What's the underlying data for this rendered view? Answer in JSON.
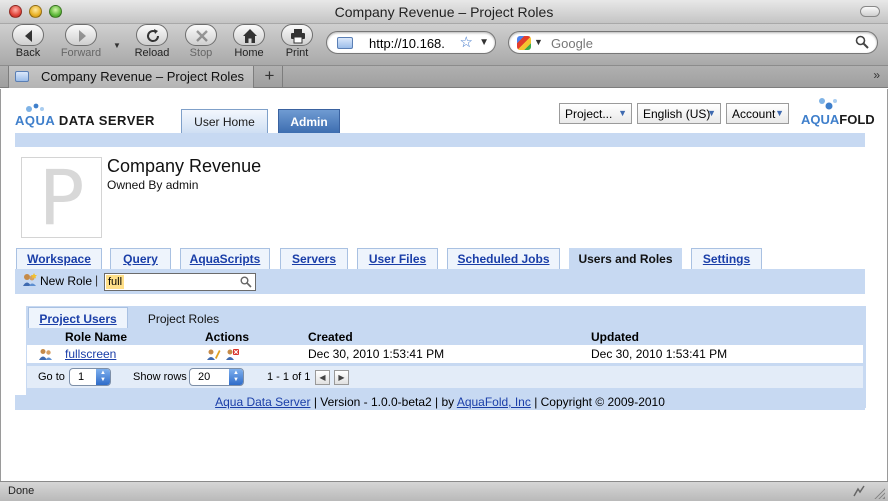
{
  "window": {
    "title": "Company Revenue – Project Roles"
  },
  "toolbar": {
    "back_label": "Back",
    "forward_label": "Forward",
    "reload_label": "Reload",
    "stop_label": "Stop",
    "home_label": "Home",
    "print_label": "Print",
    "url": "http://10.168.",
    "search_placeholder": "Google"
  },
  "tabs": {
    "active_title": "Company Revenue – Project Roles",
    "new_tab": "+"
  },
  "header": {
    "logo_left": {
      "aqua": "AQUA",
      "rest": " DATA SERVER"
    },
    "logo_right": {
      "aqua": "AQUA",
      "rest": "FOLD"
    },
    "app_tabs": [
      "User Home",
      "Admin"
    ],
    "project_select": "Project...",
    "language_select": "English (US)",
    "account_select": "Account"
  },
  "project": {
    "avatar_letter": "P",
    "name": "Company Revenue",
    "owner": "Owned By admin"
  },
  "project_tabs": [
    "Workspace",
    "Query",
    "AquaScripts",
    "Servers",
    "User Files",
    "Scheduled Jobs",
    "Users and Roles",
    "Settings"
  ],
  "panel": {
    "new_role_label": "New Role",
    "separator": "|",
    "filter_value": "full"
  },
  "roles_tabs": [
    "Project Users",
    "Project Roles"
  ],
  "grid": {
    "columns": [
      "Role Name",
      "Actions",
      "Created",
      "Updated"
    ],
    "rows": [
      {
        "role_name": "fullscreen",
        "created": "Dec 30, 2010 1:53:41 PM",
        "updated": "Dec 30, 2010 1:53:41 PM"
      }
    ]
  },
  "pager": {
    "goto_label": "Go to",
    "goto_value": "1",
    "show_rows_label": "Show rows",
    "rows_value": "20",
    "range_text": "1 - 1 of 1"
  },
  "footer": {
    "product_link": "Aqua Data Server",
    "version_text": " | Version - 1.0.0-beta2 | by ",
    "company_link": "AquaFold, Inc",
    "copyright_text": " | Copyright © 2009-2010"
  },
  "status": {
    "text": "Done"
  },
  "colors": {
    "accent": "#3f7fcb",
    "band": "#c7d9f2",
    "link": "#1a3ea8"
  }
}
